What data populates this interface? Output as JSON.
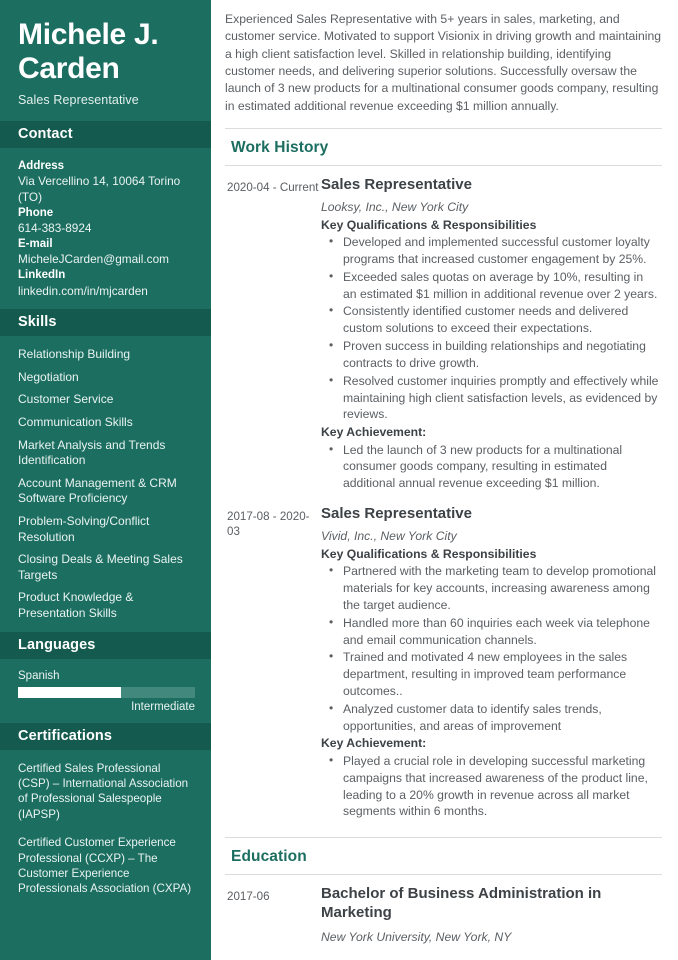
{
  "sidebar": {
    "name": "Michele J. Carden",
    "job_title": "Sales Representative",
    "contact": {
      "heading": "Contact",
      "fields": [
        {
          "label": "Address",
          "value": "Via Vercellino 14, 10064 Torino (TO)"
        },
        {
          "label": "Phone",
          "value": "614-383-8924"
        },
        {
          "label": "E-mail",
          "value": "MicheleJCarden@gmail.com"
        },
        {
          "label": "LinkedIn",
          "value": "linkedin.com/in/mjcarden"
        }
      ]
    },
    "skills": {
      "heading": "Skills",
      "items": [
        "Relationship Building",
        "Negotiation",
        "Customer Service",
        "Communication Skills",
        "Market Analysis and Trends Identification",
        "Account Management & CRM Software Proficiency",
        "Problem-Solving/Conflict Resolution",
        "Closing Deals & Meeting Sales Targets",
        "Product Knowledge & Presentation Skills"
      ]
    },
    "languages": {
      "heading": "Languages",
      "items": [
        {
          "name": "Spanish",
          "level": "Intermediate",
          "fill_percent": 58
        }
      ]
    },
    "certifications": {
      "heading": "Certifications",
      "items": [
        "Certified Sales Professional (CSP) – International Association of Professional Salespeople (IAPSP)",
        "Certified Customer Experience Professional (CCXP) – The Customer Experience Professionals Association (CXPA)"
      ]
    }
  },
  "main": {
    "summary": "Experienced Sales Representative with 5+ years in sales, marketing, and customer service. Motivated to support Visionix in driving growth and maintaining a high client satisfaction level. Skilled in relationship building, identifying customer needs, and delivering superior solutions. Successfully oversaw the launch of 3 new products for a multinational consumer goods company, resulting in estimated additional revenue exceeding $1 million annually.",
    "work_history": {
      "heading": "Work History",
      "entries": [
        {
          "date": "2020-04 - Current",
          "role": "Sales Representative",
          "organization": "Looksy, Inc., New York City",
          "qualifications_label": "Key Qualifications & Responsibilities",
          "qualifications": [
            "Developed and implemented successful customer loyalty programs that increased customer engagement by 25%.",
            "Exceeded sales quotas on average by 10%, resulting in an estimated $1 million in additional revenue over 2 years.",
            "Consistently identified customer needs and delivered custom solutions to exceed their expectations.",
            "Proven success in building relationships and negotiating contracts to drive growth.",
            "Resolved customer inquiries promptly and effectively while maintaining high client satisfaction levels, as evidenced by reviews."
          ],
          "achievement_label": "Key Achievement:",
          "achievements": [
            "Led the launch of 3 new products for a multinational consumer goods company, resulting in estimated additional annual revenue exceeding $1 million."
          ]
        },
        {
          "date": "2017-08 - 2020-03",
          "role": "Sales Representative",
          "organization": "Vivid, Inc., New York City",
          "qualifications_label": "Key Qualifications & Responsibilities",
          "qualifications": [
            "Partnered with the marketing team to develop promotional materials for key accounts, increasing awareness among the target audience.",
            "Handled more than 60 inquiries each week via telephone and email communication channels.",
            "Trained and motivated 4 new employees in the sales department, resulting in improved team performance outcomes..",
            "Analyzed customer data to identify sales trends, opportunities, and areas of improvement"
          ],
          "achievement_label": "Key Achievement:",
          "achievements": [
            "Played a crucial role in developing successful marketing campaigns that increased awareness of the product line, leading to a 20% growth in revenue across all market segments within 6 months."
          ]
        }
      ]
    },
    "education": {
      "heading": "Education",
      "entries": [
        {
          "date": "2017-06",
          "degree": "Bachelor of Business Administration in Marketing",
          "school": "New York University, New York, NY"
        }
      ]
    }
  },
  "theme": {
    "sidebar_bg": "#1b6e60",
    "sidebar_head_bg": "#155a4e",
    "accent": "#1b6e60",
    "body_text": "#5b5f63",
    "heading_text": "#3d4246"
  }
}
